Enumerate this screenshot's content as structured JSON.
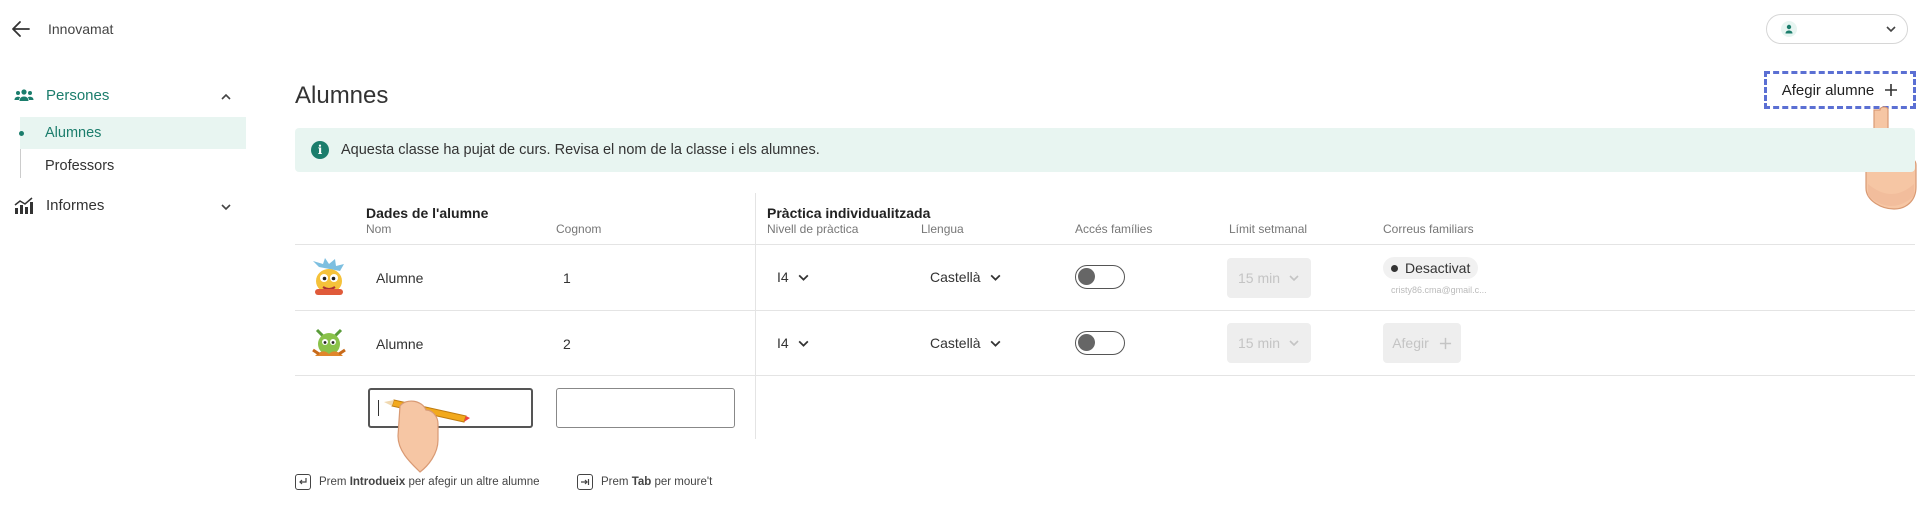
{
  "topbar": {
    "app_name": "Innovamat"
  },
  "sidebar": {
    "groups": [
      {
        "label": "Persones",
        "items": [
          {
            "label": "Alumnes",
            "active": true
          },
          {
            "label": "Professors",
            "active": false
          }
        ]
      },
      {
        "label": "Informes",
        "items": []
      }
    ]
  },
  "main": {
    "title": "Alumnes",
    "add_button_label": "Afegir alumne",
    "banner_text": "Aquesta classe ha pujat de curs. Revisa el nom de la classe i els alumnes.",
    "table": {
      "group_student": "Dades de l'alumne",
      "group_practice": "Pràctica individualitzada",
      "columns": {
        "name": "Nom",
        "surname": "Cognom",
        "level": "Nivell de pràctica",
        "language": "Llengua",
        "family_access": "Accés famílies",
        "weekly_limit": "Límit setmanal",
        "family_emails": "Correus familiars"
      },
      "rows": [
        {
          "name": "Alumne",
          "surname": "1",
          "level": "I4",
          "language": "Castellà",
          "family_access": false,
          "weekly_limit": "15 min",
          "family_status": "Desactivat",
          "family_email": "cristy86.cma@gmail.c..."
        },
        {
          "name": "Alumne",
          "surname": "2",
          "level": "I4",
          "language": "Castellà",
          "family_access": false,
          "weekly_limit": "15 min",
          "family_add_label": "Afegir"
        }
      ]
    },
    "hints": {
      "enter_prefix": "Prem",
      "enter_key": "Introdueix",
      "enter_suffix": "per afegir un altre alumne",
      "tab_prefix": "Prem",
      "tab_key": "Tab",
      "tab_suffix": "per moure't"
    }
  },
  "colors": {
    "accent": "#1b7d6c",
    "banner_bg": "#e8f5f1",
    "highlight_dash": "#5b6fd3"
  }
}
